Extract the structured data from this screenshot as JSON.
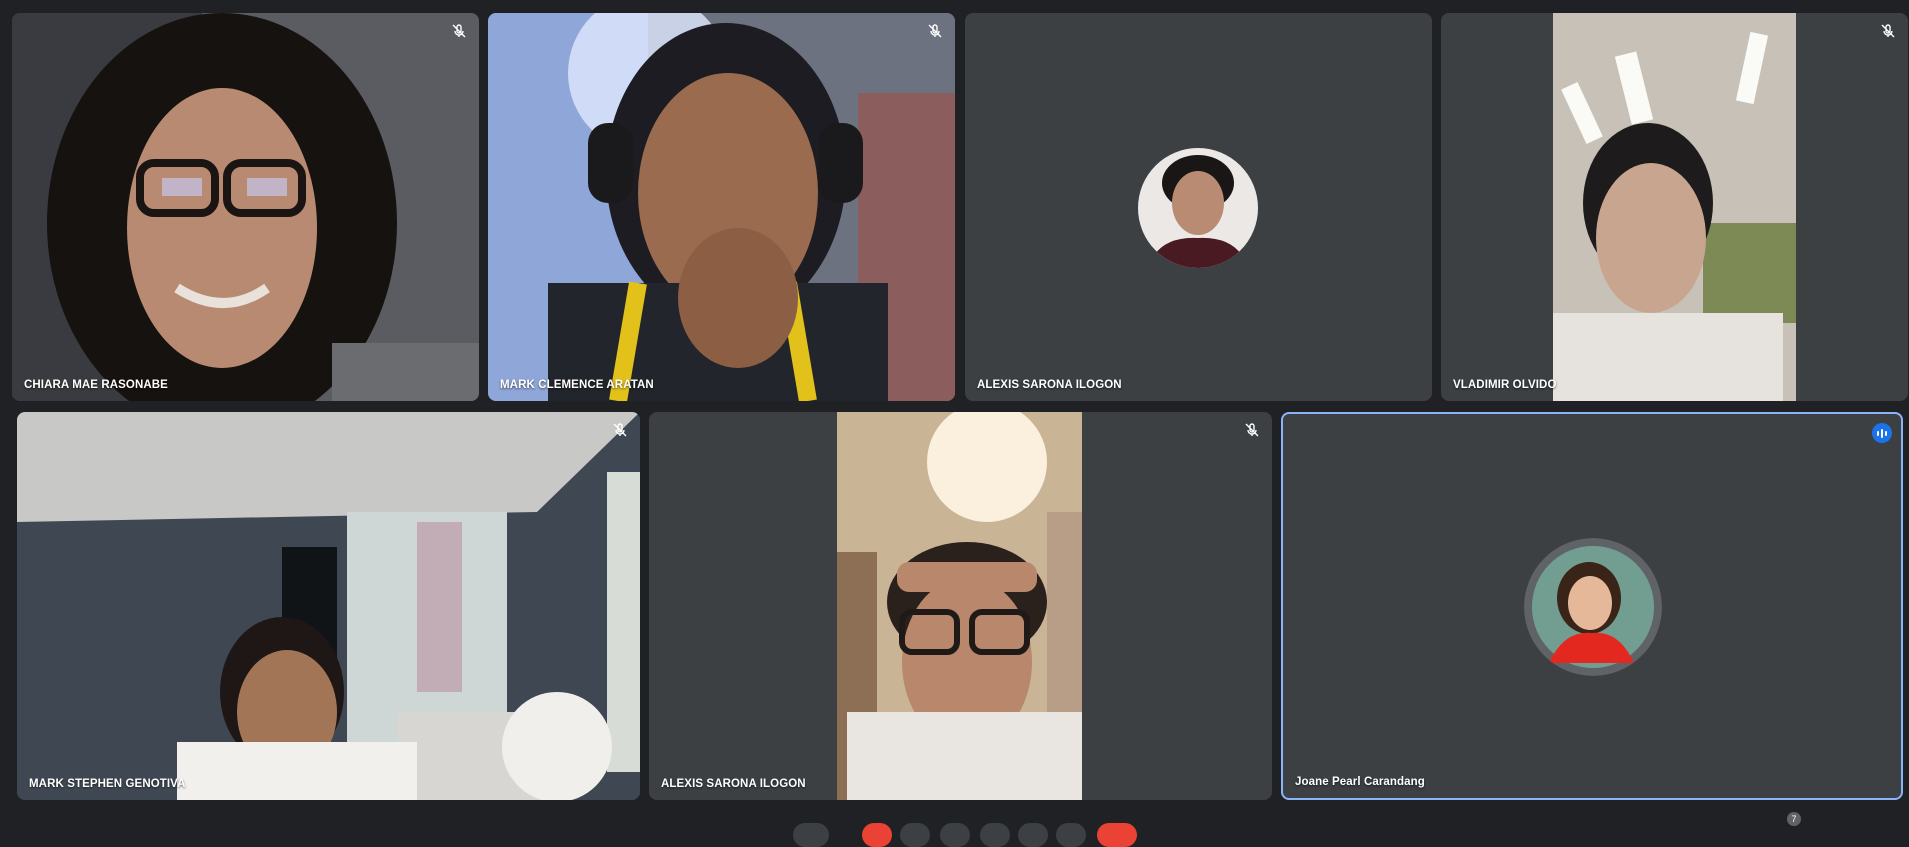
{
  "participants": [
    {
      "name": "CHIARA MAE RASONABE",
      "muted": true
    },
    {
      "name": "MARK CLEMENCE ARATAN",
      "muted": true
    },
    {
      "name": "ALEXIS SARONA ILOGON",
      "muted": false
    },
    {
      "name": "VLADIMIR OLVIDO",
      "muted": true
    },
    {
      "name": "MARK STEPHEN GENOTIVA",
      "muted": true
    },
    {
      "name": "ALEXIS SARONA ILOGON",
      "muted": true
    },
    {
      "name": "Joane Pearl Carandang",
      "muted": false,
      "speaking": true
    }
  ],
  "participant_count": "7",
  "colors": {
    "tile_bg": "#3c4043",
    "page_bg": "#202124",
    "active_border": "#8ab4f8",
    "speaking_badge": "#1a73e8",
    "leave": "#ea4335"
  }
}
